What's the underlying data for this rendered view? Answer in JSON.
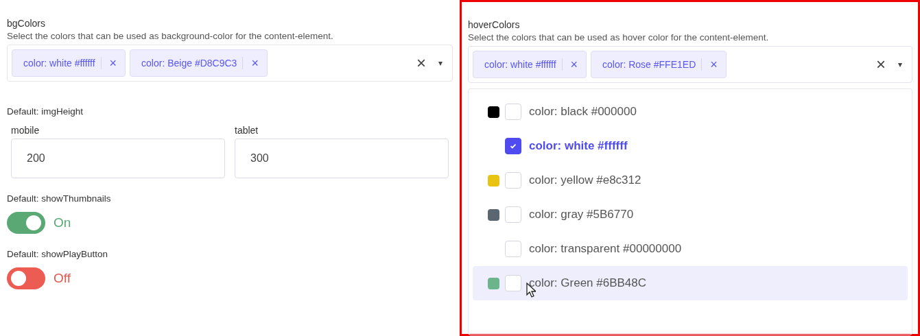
{
  "left": {
    "bgColors": {
      "label": "bgColors",
      "description": "Select the colors that can be used as background-color for the content-element.",
      "tags": [
        {
          "label": "color: white #ffffff",
          "remove": "×"
        },
        {
          "label": "color: Beige #D8C9C3",
          "remove": "×"
        }
      ],
      "clear": "×",
      "caret": "▾"
    },
    "imgHeight": {
      "label": "Default: imgHeight",
      "fields": [
        {
          "label": "mobile",
          "value": "200"
        },
        {
          "label": "tablet",
          "value": "300"
        }
      ]
    },
    "toggles": [
      {
        "label": "Default: showThumbnails",
        "on": true,
        "state_text": "On"
      },
      {
        "label": "Default: showPlayButton",
        "on": false,
        "state_text": "Off"
      }
    ]
  },
  "right": {
    "highlighted": true,
    "label": "hoverColors",
    "description": "Select the colors that can be used as hover color for the content-element.",
    "tags": [
      {
        "label": "color: white #ffffff",
        "remove": "×"
      },
      {
        "label": "color: Rose #FFE1ED",
        "remove": "×"
      }
    ],
    "clear": "×",
    "caret": "▾",
    "options": [
      {
        "label": "color: black #000000",
        "color": "#000000",
        "checked": false,
        "hovered": false
      },
      {
        "label": "color: white #ffffff",
        "checked": true,
        "hovered": false
      },
      {
        "label": "color: yellow #e8c312",
        "color": "#e8c312",
        "checked": false,
        "hovered": false
      },
      {
        "label": "color: gray #5B6770",
        "color": "#5b6770",
        "checked": false,
        "hovered": false
      },
      {
        "label": "color: transparent #00000000",
        "checked": false,
        "hovered": false
      },
      {
        "label": "color: Green #6BB48C",
        "color": "#6bb48c",
        "checked": false,
        "hovered": true
      }
    ]
  }
}
